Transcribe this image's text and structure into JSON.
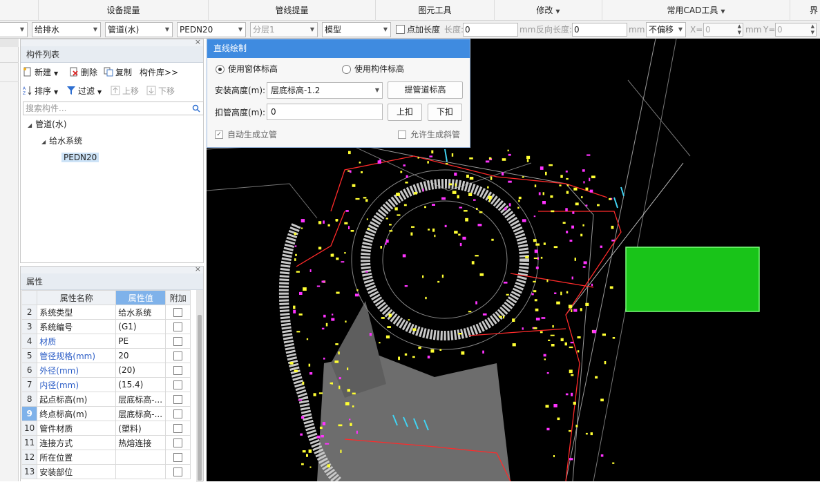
{
  "ribbon": {
    "groups": [
      "设备提量",
      "管线提量",
      "图元工具",
      "修改",
      "常用CAD工具",
      "界"
    ]
  },
  "toolbar": {
    "category": "给排水",
    "component_type": "管道(水)",
    "component_name": "PEDN20",
    "layer": "分层1",
    "mode": "模型",
    "add_length_label": "点加长度",
    "length_label": "长度:",
    "length_value": "0",
    "length_unit": "mm",
    "reverse_length_label": "反向长度:",
    "reverse_length_value": "0",
    "reverse_length_unit": "mm",
    "offset_option": "不偏移",
    "x_label": "X=",
    "x_value": "0",
    "x_unit": "mm",
    "y_label": "Y=",
    "y_value": "0"
  },
  "component_list": {
    "title": "构件列表",
    "new_label": "新建",
    "delete_label": "删除",
    "copy_label": "复制",
    "library_label": "构件库>>",
    "sort_label": "排序",
    "filter_label": "过滤",
    "move_up_label": "上移",
    "move_down_label": "下移",
    "search_placeholder": "搜索构件...",
    "tree": {
      "root": "管道(水)",
      "system": "给水系统",
      "item": "PEDN20"
    }
  },
  "properties": {
    "title": "属性",
    "col_name": "属性名称",
    "col_value": "属性值",
    "col_extra": "附加",
    "rows": [
      {
        "num": "2",
        "name": "系统类型",
        "value": "给水系统"
      },
      {
        "num": "3",
        "name": "系统编号",
        "value": "(G1)"
      },
      {
        "num": "4",
        "name": "材质",
        "value": "PE"
      },
      {
        "num": "5",
        "name": "管径规格(mm)",
        "value": "20"
      },
      {
        "num": "6",
        "name": "外径(mm)",
        "value": "(20)"
      },
      {
        "num": "7",
        "name": "内径(mm)",
        "value": "(15.4)"
      },
      {
        "num": "8",
        "name": "起点标高(m)",
        "value": "层底标高-..."
      },
      {
        "num": "9",
        "name": "终点标高(m)",
        "value": "层底标高-..."
      },
      {
        "num": "10",
        "name": "管件材质",
        "value": "(塑料)"
      },
      {
        "num": "11",
        "name": "连接方式",
        "value": "热熔连接"
      },
      {
        "num": "12",
        "name": "所在位置",
        "value": ""
      },
      {
        "num": "13",
        "name": "安装部位",
        "value": ""
      }
    ]
  },
  "dialog": {
    "title": "直线绘制",
    "use_window_elevation": "使用窗体标高",
    "use_component_elevation": "使用构件标高",
    "install_height_label": "安装高度(m):",
    "install_height_value": "层底标高-1.2",
    "pick_elevation_button": "提管道标高",
    "deduct_height_label": "扣管高度(m):",
    "deduct_height_value": "0",
    "deduct_up_button": "上扣",
    "deduct_down_button": "下扣",
    "auto_riser_label": "自动生成立管",
    "allow_slope_label": "允许生成斜管"
  },
  "colors": {
    "canvas_bg": "#000000",
    "dialog_title_bg": "#3f8be0",
    "highlight_green": "#19c419",
    "pipe_red": "#ff2a2a",
    "fitting_magenta": "#ff33ff",
    "fitting_yellow": "#ffff33"
  }
}
